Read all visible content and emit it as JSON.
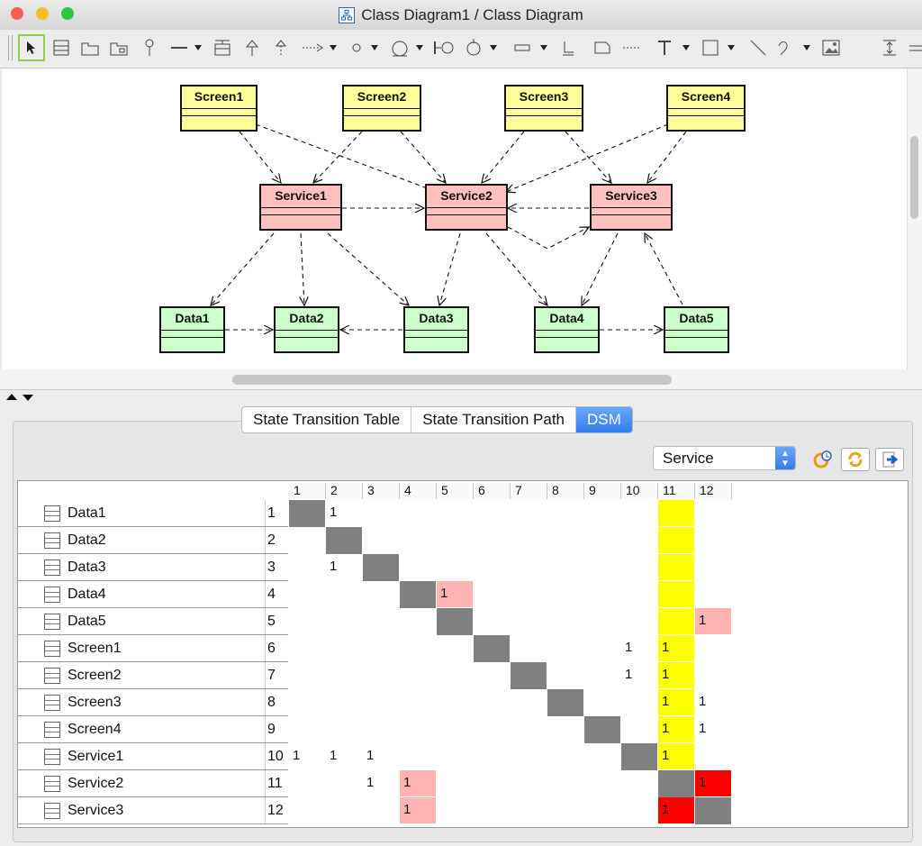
{
  "window": {
    "title": "Class Diagram1 / Class Diagram"
  },
  "diagram": {
    "nodes": [
      {
        "id": "Screen1",
        "kind": "scr"
      },
      {
        "id": "Screen2",
        "kind": "scr"
      },
      {
        "id": "Screen3",
        "kind": "scr"
      },
      {
        "id": "Screen4",
        "kind": "scr"
      },
      {
        "id": "Service1",
        "kind": "svc"
      },
      {
        "id": "Service2",
        "kind": "svc"
      },
      {
        "id": "Service3",
        "kind": "svc"
      },
      {
        "id": "Data1",
        "kind": "dat"
      },
      {
        "id": "Data2",
        "kind": "dat"
      },
      {
        "id": "Data3",
        "kind": "dat"
      },
      {
        "id": "Data4",
        "kind": "dat"
      },
      {
        "id": "Data5",
        "kind": "dat"
      }
    ],
    "edges": [
      [
        "Screen1",
        "Service1"
      ],
      [
        "Screen1",
        "Service2"
      ],
      [
        "Screen2",
        "Service1"
      ],
      [
        "Screen2",
        "Service2"
      ],
      [
        "Screen3",
        "Service2"
      ],
      [
        "Screen3",
        "Service3"
      ],
      [
        "Screen4",
        "Service2"
      ],
      [
        "Screen4",
        "Service3"
      ],
      [
        "Service1",
        "Service2"
      ],
      [
        "Service3",
        "Service2"
      ],
      [
        "Service2",
        "Service3"
      ],
      [
        "Service1",
        "Data1"
      ],
      [
        "Service1",
        "Data2"
      ],
      [
        "Service1",
        "Data3"
      ],
      [
        "Service2",
        "Data3"
      ],
      [
        "Service2",
        "Data4"
      ],
      [
        "Service3",
        "Data4"
      ],
      [
        "Data5",
        "Service3"
      ],
      [
        "Data1",
        "Data2"
      ],
      [
        "Data3",
        "Data2"
      ],
      [
        "Data4",
        "Data5"
      ]
    ]
  },
  "tabs": [
    {
      "label": "State Transition Table",
      "active": false
    },
    {
      "label": "State Transition Path",
      "active": false
    },
    {
      "label": "DSM",
      "active": true
    }
  ],
  "filter": {
    "value": "Service"
  },
  "dsm": {
    "columns": [
      "1",
      "2",
      "3",
      "4",
      "5",
      "6",
      "7",
      "8",
      "9",
      "10",
      "11",
      "12"
    ],
    "rows": [
      {
        "name": "Data1",
        "num": "1"
      },
      {
        "name": "Data2",
        "num": "2"
      },
      {
        "name": "Data3",
        "num": "3"
      },
      {
        "name": "Data4",
        "num": "4"
      },
      {
        "name": "Data5",
        "num": "5"
      },
      {
        "name": "Screen1",
        "num": "6"
      },
      {
        "name": "Screen2",
        "num": "7"
      },
      {
        "name": "Screen3",
        "num": "8"
      },
      {
        "name": "Screen4",
        "num": "9"
      },
      {
        "name": "Service1",
        "num": "10"
      },
      {
        "name": "Service2",
        "num": "11"
      },
      {
        "name": "Service3",
        "num": "12"
      }
    ],
    "cells": [
      {
        "r": 1,
        "c": 2,
        "v": "1",
        "bg": ""
      },
      {
        "r": 3,
        "c": 2,
        "v": "1",
        "bg": ""
      },
      {
        "r": 4,
        "c": 5,
        "v": "1",
        "bg": "pink"
      },
      {
        "r": 5,
        "c": 12,
        "v": "1",
        "bg": "pink"
      },
      {
        "r": 6,
        "c": 10,
        "v": "1",
        "bg": ""
      },
      {
        "r": 6,
        "c": 11,
        "v": "1",
        "bg": "yellow"
      },
      {
        "r": 7,
        "c": 10,
        "v": "1",
        "bg": ""
      },
      {
        "r": 7,
        "c": 11,
        "v": "1",
        "bg": "yellow"
      },
      {
        "r": 8,
        "c": 11,
        "v": "1",
        "bg": "yellow"
      },
      {
        "r": 8,
        "c": 12,
        "v": "1",
        "bg": ""
      },
      {
        "r": 9,
        "c": 11,
        "v": "1",
        "bg": "yellow"
      },
      {
        "r": 9,
        "c": 12,
        "v": "1",
        "bg": ""
      },
      {
        "r": 10,
        "c": 1,
        "v": "1",
        "bg": ""
      },
      {
        "r": 10,
        "c": 2,
        "v": "1",
        "bg": ""
      },
      {
        "r": 10,
        "c": 3,
        "v": "1",
        "bg": ""
      },
      {
        "r": 10,
        "c": 11,
        "v": "1",
        "bg": "yellow"
      },
      {
        "r": 11,
        "c": 3,
        "v": "1",
        "bg": ""
      },
      {
        "r": 11,
        "c": 4,
        "v": "1",
        "bg": "pink"
      },
      {
        "r": 11,
        "c": 12,
        "v": "1",
        "bg": "red"
      },
      {
        "r": 12,
        "c": 4,
        "v": "1",
        "bg": "pink"
      },
      {
        "r": 12,
        "c": 11,
        "v": "1",
        "bg": "red"
      },
      {
        "r": 1,
        "c": 11,
        "v": "",
        "bg": "yellow"
      },
      {
        "r": 2,
        "c": 11,
        "v": "",
        "bg": "yellow"
      },
      {
        "r": 3,
        "c": 11,
        "v": "",
        "bg": "yellow"
      },
      {
        "r": 4,
        "c": 11,
        "v": "",
        "bg": "yellow"
      },
      {
        "r": 5,
        "c": 11,
        "v": "",
        "bg": "yellow"
      }
    ]
  },
  "colors": {
    "screen": "#ffff99",
    "service": "#ffc0c0",
    "data": "#ccffcc",
    "accent": "#2f7ef2"
  },
  "icons": [
    "select-tool-icon",
    "class-icon",
    "package-icon",
    "interface-icon",
    "line-icon",
    "generalization-icon",
    "text-icon",
    "rectangle-icon",
    "image-icon",
    "refresh-icon",
    "export-icon"
  ]
}
